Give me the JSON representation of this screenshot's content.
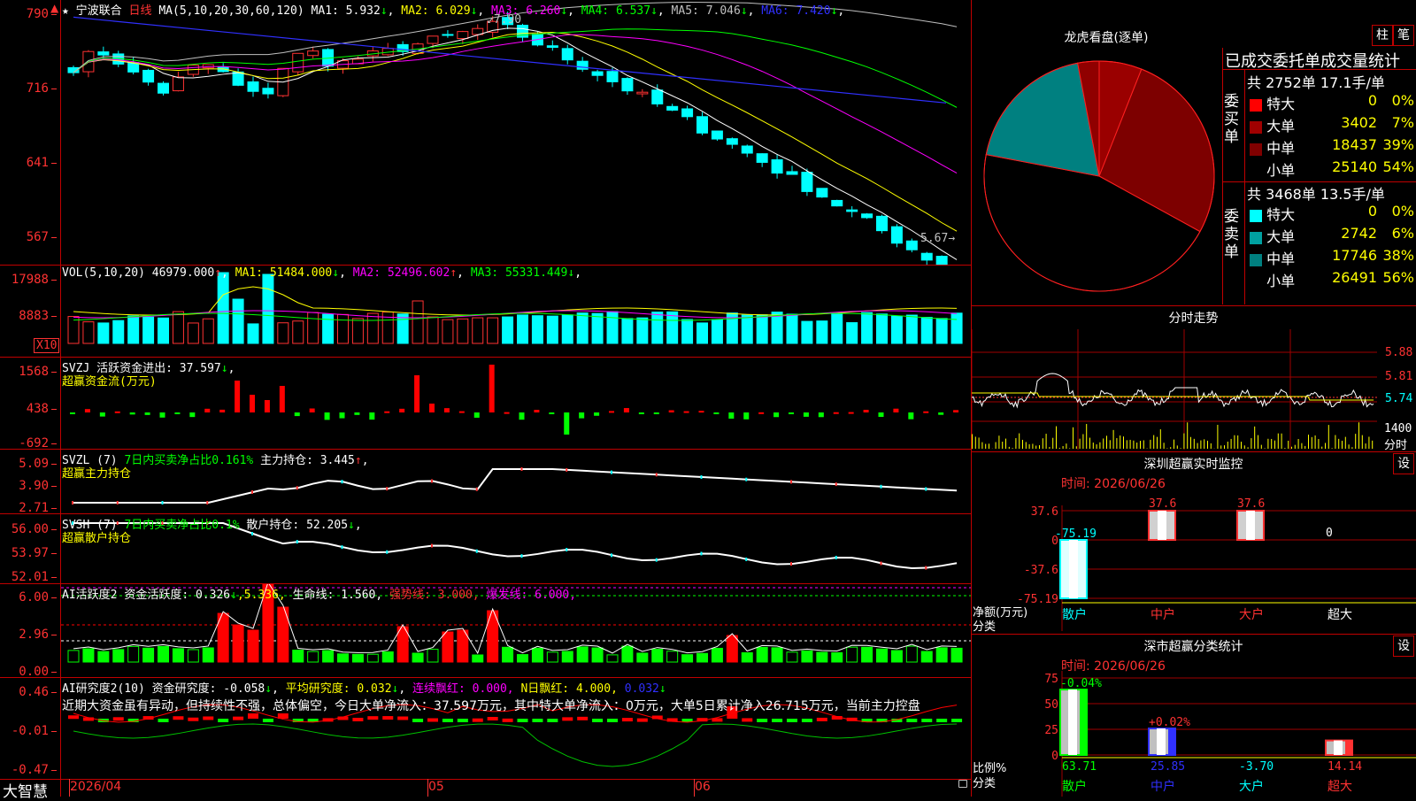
{
  "main": {
    "stock": "宁波联合",
    "period": "日线",
    "ma": {
      "label": "MA(5,10,20,30,60,120)",
      "items": [
        {
          "name": "MA1:",
          "value": "5.932",
          "arrow": "↓",
          "color": "#ffffff"
        },
        {
          "name": "MA2:",
          "value": "6.029",
          "arrow": "↓",
          "color": "#ffff00"
        },
        {
          "name": "MA3:",
          "value": "6.260",
          "arrow": "↓",
          "color": "#ff00ff"
        },
        {
          "name": "MA4:",
          "value": "6.537",
          "arrow": "↓",
          "color": "#00ff00"
        },
        {
          "name": "MA5:",
          "value": "7.046",
          "arrow": "↓",
          "color": "#c0c0c0"
        },
        {
          "name": "MA6:",
          "value": "7.420",
          "arrow": "↓",
          "color": "#3030ff"
        }
      ]
    },
    "yticks": [
      "790",
      "716",
      "641",
      "567"
    ],
    "high_label": "7.90",
    "low_label": "5.67"
  },
  "vol": {
    "label": "VOL(5,10,20)",
    "value": "46979.000",
    "arrow": "↑",
    "mas": [
      {
        "name": "MA1:",
        "value": "51484.000",
        "arrow": "↓",
        "color": "#ffff00"
      },
      {
        "name": "MA2:",
        "value": "52496.602",
        "arrow": "↑",
        "color": "#ff00ff"
      },
      {
        "name": "MA3:",
        "value": "55331.449",
        "arrow": "↓",
        "color": "#00ff00"
      }
    ],
    "yticks": [
      "17988",
      "8883"
    ],
    "unit": "X10"
  },
  "svzj": {
    "line1a": "SVZJ",
    "line1b": "活跃资金进出:",
    "value": "37.597",
    "arrow": "↓",
    "line2": "超赢资金流(万元)",
    "yticks": [
      "1568",
      "438",
      "-692"
    ]
  },
  "svzl": {
    "a": "SVZL (7)",
    "b": "7日内买卖净占比0.161%",
    "c": "主力持仓: 3.445",
    "arrow": "↑",
    "d": ",",
    "line2": "超赢主力持仓",
    "yticks": [
      "5.09",
      "3.90",
      "2.71"
    ]
  },
  "svsh": {
    "a": "SVSH (7)",
    "b": "7日内买卖净占比0.1%",
    "c": "散户持仓: 52.205",
    "arrow": "↓",
    "d": ",",
    "line2": "超赢散户持仓",
    "yticks": [
      "56.00",
      "53.97",
      "52.01"
    ]
  },
  "hyd": {
    "a": "AI活跃度2",
    "b": "资金活跃度: 0.326",
    "b_arrow": "↓",
    "b2": ",5.336,",
    "c": "生命线: 1.560,",
    "d": "强势线: 3.000,",
    "e": "爆发线: 6.000,",
    "yticks": [
      "6.00",
      "2.96",
      "0.00"
    ]
  },
  "yjd": {
    "a": "AI研究度2(10)",
    "b": "资金研究度: -0.058",
    "b_arrow": "↓",
    "c": "平均研究度: 0.032",
    "c_arrow": "↓",
    "d": "连续飘红: 0.000,",
    "e": "N日飘红: 4.000,",
    "f": "0.032",
    "f_arrow": "↓",
    "comment": "近期大资金虽有异动，但持续性不强，总体偏空，今日大单净流入：37.597万元，其中特大单净流入：0万元，大单5日累计净入26.715万元，当前主力控盘",
    "yticks": [
      "0.46",
      "-0.01",
      "-0.47"
    ]
  },
  "xaxis": {
    "brand": "大智慧",
    "labels": [
      "2026/04",
      "05",
      "06"
    ]
  },
  "lhb": {
    "title": "龙虎看盘(逐单)",
    "btn1": "柱",
    "btn2": "笔",
    "header": "已成交委托单成交量统计",
    "buy": {
      "side": "委买单",
      "total": "共 2752单 17.1手/单",
      "rows": [
        {
          "name": "特大",
          "vol": "0",
          "pct": "0%",
          "color": "#ff0000"
        },
        {
          "name": "大单",
          "vol": "3402",
          "pct": "7%",
          "color": "#a00000"
        },
        {
          "name": "中单",
          "vol": "18437",
          "pct": "39%",
          "color": "#800000"
        },
        {
          "name": "小单",
          "vol": "25140",
          "pct": "54%",
          "color": "#000000"
        }
      ]
    },
    "sell": {
      "side": "委卖单",
      "total": "共 3468单 13.5手/单",
      "rows": [
        {
          "name": "特大",
          "vol": "0",
          "pct": "0%",
          "color": "#00ffff"
        },
        {
          "name": "大单",
          "vol": "2742",
          "pct": "6%",
          "color": "#00a0a0"
        },
        {
          "name": "中单",
          "vol": "17746",
          "pct": "38%",
          "color": "#008080"
        },
        {
          "name": "小单",
          "vol": "26491",
          "pct": "56%",
          "color": "#000000"
        }
      ]
    }
  },
  "fs": {
    "title": "分时走势",
    "yticks": [
      "5.88",
      "5.81",
      "5.74"
    ],
    "vol_tick": "1400",
    "unit": "分时"
  },
  "szjk": {
    "title": "深圳超赢实时监控",
    "btn": "设",
    "time": "时间: 2026/06/26",
    "yticks": [
      "37.6",
      "0",
      "-37.6",
      "-75.19"
    ],
    "ylabel1": "净额(万元)",
    "ylabel2": "分类",
    "bars": [
      {
        "cat": "散户",
        "value": "-75.19"
      },
      {
        "cat": "中户",
        "value": "37.6"
      },
      {
        "cat": "大户",
        "value": "37.6"
      },
      {
        "cat": "超大",
        "value": "0"
      }
    ]
  },
  "sstj": {
    "title": "深市超赢分类统计",
    "btn": "设",
    "time": "时间: 2026/06/26",
    "yticks": [
      "75",
      "50",
      "25",
      "0"
    ],
    "ylabel1": "比例%",
    "ylabel2": "分类",
    "bars": [
      {
        "cat": "散户",
        "top": "-0.04%",
        "bottom": "63.71",
        "pct": 63.71
      },
      {
        "cat": "中户",
        "top": "+0.02%",
        "bottom": "25.85",
        "pct": 25.85
      },
      {
        "cat": "大户",
        "top": "",
        "bottom": "-3.70",
        "pct": 0
      },
      {
        "cat": "超大",
        "top": "",
        "bottom": "14.14",
        "pct": 14.14
      }
    ]
  }
}
